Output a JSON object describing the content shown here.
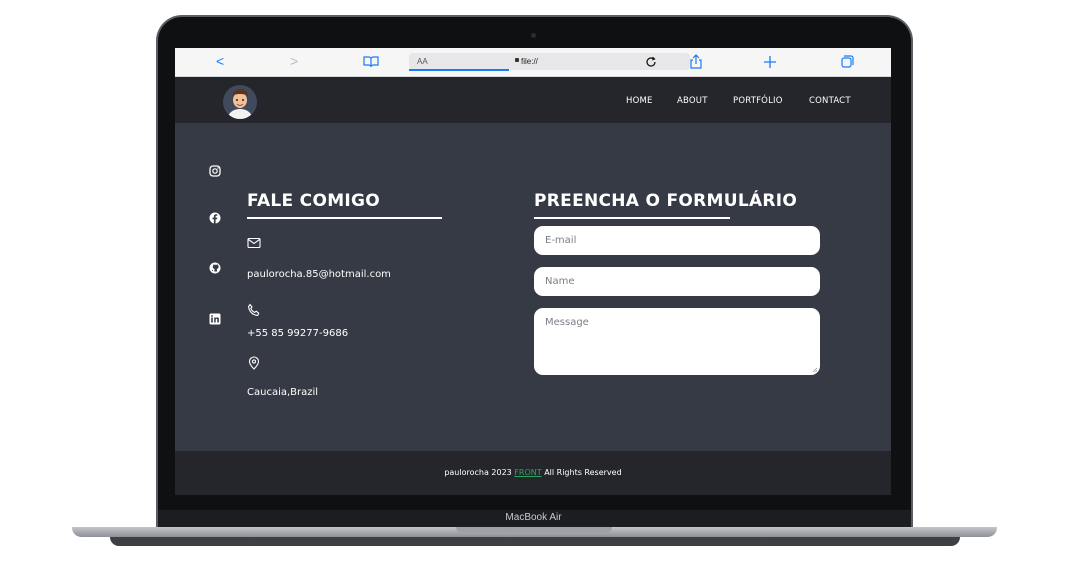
{
  "device": {
    "label": "MacBook Air"
  },
  "browser": {
    "aa_label": "AA",
    "url": "file://",
    "back": "<",
    "forward": ">"
  },
  "nav": {
    "links": [
      "HOME",
      "ABOUT",
      "PORTFÓLIO",
      "CONTACT"
    ]
  },
  "social": [
    "instagram-icon",
    "facebook-icon",
    "github-icon",
    "linkedin-icon"
  ],
  "contact": {
    "title": "FALE COMIGO",
    "email": "paulorocha.85@hotmail.com",
    "phone": "+55 85 99277-9686",
    "location": "Caucaia,Brazil"
  },
  "form": {
    "title": "PREENCHA O FORMULÁRIO",
    "email_placeholder": "E-mail",
    "name_placeholder": "Name",
    "message_placeholder": "Message"
  },
  "footer": {
    "prefix": "paulorocha 2023",
    "accent": "FRONT",
    "suffix": "All Rights Reserved"
  },
  "colors": {
    "page_bg": "#363a44",
    "nav_bg": "#24262c",
    "accent": "#2fa35a",
    "safari_blue": "#1a7cf5"
  }
}
